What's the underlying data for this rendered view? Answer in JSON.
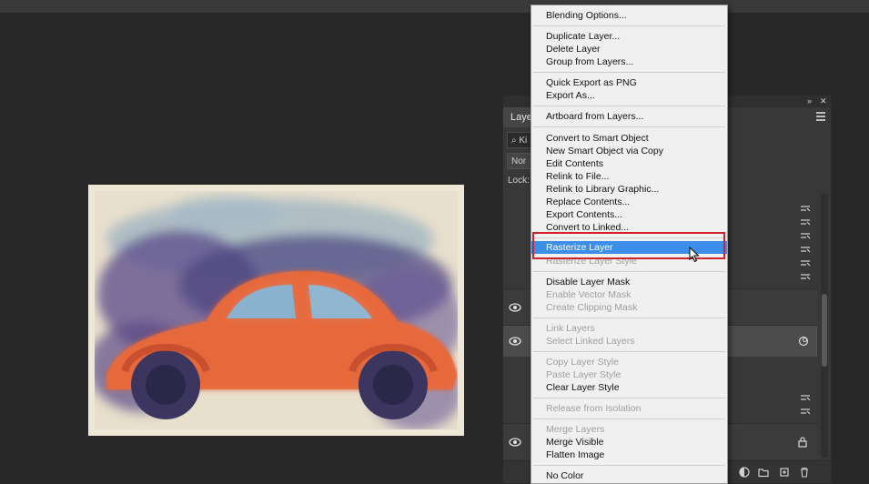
{
  "layers_panel": {
    "tab_label": "Laye",
    "filter_text": "Ki",
    "blend_mode": "Nor",
    "lock_label": "Lock:"
  },
  "context_menu": {
    "items": [
      {
        "label": "Blending Options...",
        "enabled": true
      },
      {
        "label": "Duplicate Layer...",
        "enabled": true
      },
      {
        "label": "Delete Layer",
        "enabled": true
      },
      {
        "label": "Group from Layers...",
        "enabled": true
      },
      {
        "label": "Quick Export as PNG",
        "enabled": true
      },
      {
        "label": "Export As...",
        "enabled": true
      },
      {
        "label": "Artboard from Layers...",
        "enabled": true
      },
      {
        "label": "Convert to Smart Object",
        "enabled": true
      },
      {
        "label": "New Smart Object via Copy",
        "enabled": true
      },
      {
        "label": "Edit Contents",
        "enabled": true
      },
      {
        "label": "Relink to File...",
        "enabled": true
      },
      {
        "label": "Relink to Library Graphic...",
        "enabled": true
      },
      {
        "label": "Replace Contents...",
        "enabled": true
      },
      {
        "label": "Export Contents...",
        "enabled": true
      },
      {
        "label": "Convert to Linked...",
        "enabled": true
      },
      {
        "label": "Rasterize Layer",
        "enabled": true,
        "highlighted": true
      },
      {
        "label": "Rasterize Layer Style",
        "enabled": false
      },
      {
        "label": "Disable Layer Mask",
        "enabled": true
      },
      {
        "label": "Enable Vector Mask",
        "enabled": false
      },
      {
        "label": "Create Clipping Mask",
        "enabled": false
      },
      {
        "label": "Link Layers",
        "enabled": false
      },
      {
        "label": "Select Linked Layers",
        "enabled": false
      },
      {
        "label": "Copy Layer Style",
        "enabled": false
      },
      {
        "label": "Paste Layer Style",
        "enabled": false
      },
      {
        "label": "Clear Layer Style",
        "enabled": true
      },
      {
        "label": "Release from Isolation",
        "enabled": false
      },
      {
        "label": "Merge Layers",
        "enabled": false
      },
      {
        "label": "Merge Visible",
        "enabled": true
      },
      {
        "label": "Flatten Image",
        "enabled": true
      },
      {
        "label": "No Color",
        "enabled": true
      }
    ]
  },
  "colors": {
    "highlight": "#3d8ee8",
    "annotation_box": "#d0222a"
  }
}
